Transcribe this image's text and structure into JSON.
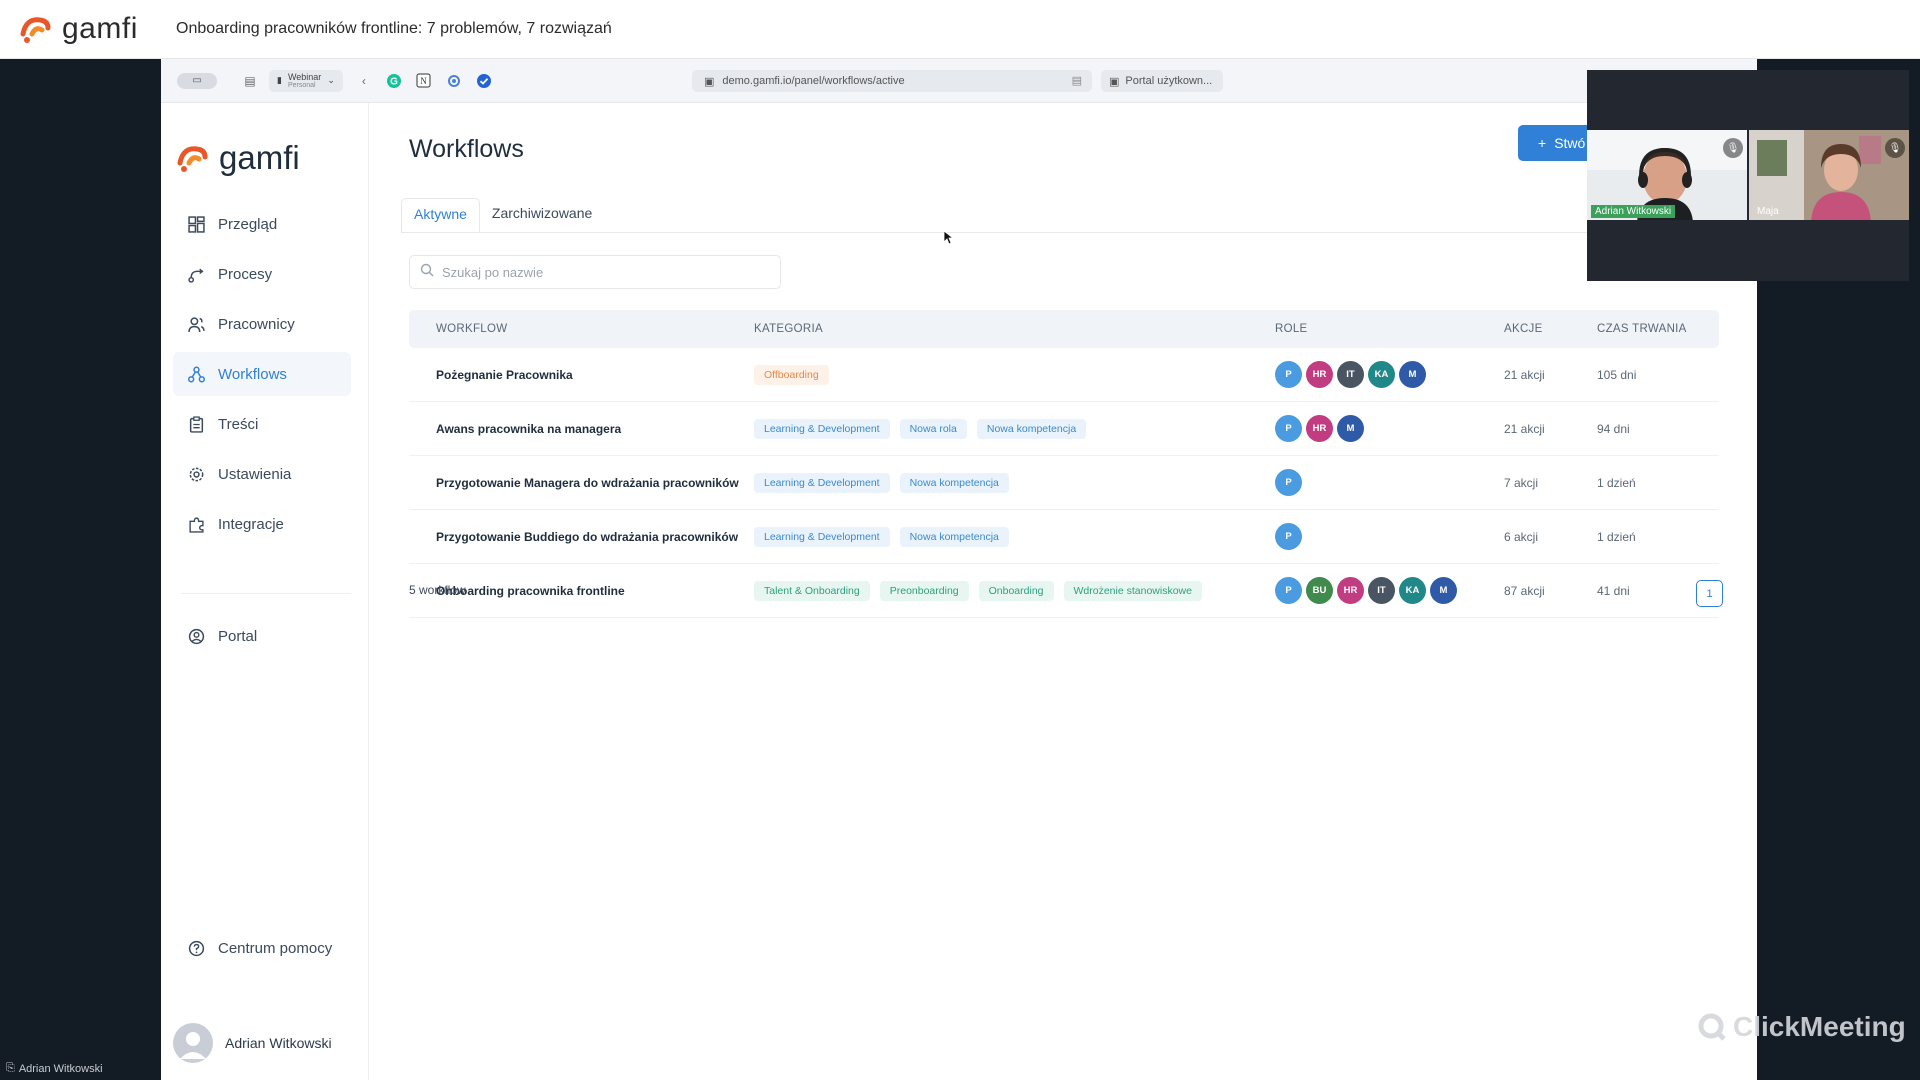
{
  "webinar": {
    "logo_text": "gamfi",
    "title": "Onboarding pracowników frontline: 7 problemów, 7 rozwiązań",
    "presenter": "Adrian Witkowski",
    "watermark": "ClickMeeting"
  },
  "browser": {
    "profile_label": "Webinar",
    "profile_sub": "Personal",
    "url": "demo.gamfi.io/panel/workflows/active",
    "second_tab": "Portal użytkown..."
  },
  "sidebar": {
    "logo_text": "gamfi",
    "items": [
      {
        "label": "Przegląd",
        "icon": "grid-icon"
      },
      {
        "label": "Procesy",
        "icon": "route-icon"
      },
      {
        "label": "Pracownicy",
        "icon": "users-icon"
      },
      {
        "label": "Workflows",
        "icon": "workflow-icon",
        "active": true
      },
      {
        "label": "Treści",
        "icon": "clipboard-icon"
      },
      {
        "label": "Ustawienia",
        "icon": "gear-icon"
      },
      {
        "label": "Integracje",
        "icon": "puzzle-icon"
      }
    ],
    "portal": "Portal",
    "help": "Centrum pomocy",
    "user": "Adrian Witkowski"
  },
  "main": {
    "title": "Workflows",
    "create_label": "Stwó",
    "tabs": [
      "Aktywne",
      "Zarchiwizowane"
    ],
    "search_placeholder": "Szukaj po nazwie",
    "columns": [
      "WORKFLOW",
      "KATEGORIA",
      "ROLE",
      "AKCJE",
      "CZAS TRWANIA"
    ],
    "rows": [
      {
        "name": "Pożegnanie Pracownika",
        "tags": [
          {
            "label": "Offboarding",
            "color": "orange"
          }
        ],
        "roles": [
          "P",
          "HR",
          "IT",
          "KA",
          "M"
        ],
        "actions": "21 akcji",
        "duration": "105 dni"
      },
      {
        "name": "Awans pracownika na managera",
        "tags": [
          {
            "label": "Learning & Development",
            "color": "blue"
          },
          {
            "label": "Nowa rola",
            "color": "blue"
          },
          {
            "label": "Nowa kompetencja",
            "color": "blue"
          }
        ],
        "roles": [
          "P",
          "HR",
          "M"
        ],
        "actions": "21 akcji",
        "duration": "94 dni"
      },
      {
        "name": "Przygotowanie Managera do wdrażania pracowników",
        "tags": [
          {
            "label": "Learning & Development",
            "color": "blue"
          },
          {
            "label": "Nowa kompetencja",
            "color": "blue"
          }
        ],
        "roles": [
          "P"
        ],
        "actions": "7 akcji",
        "duration": "1 dzień"
      },
      {
        "name": "Przygotowanie Buddiego do wdrażania pracowników",
        "tags": [
          {
            "label": "Learning & Development",
            "color": "blue"
          },
          {
            "label": "Nowa kompetencja",
            "color": "blue"
          }
        ],
        "roles": [
          "P"
        ],
        "actions": "6 akcji",
        "duration": "1 dzień"
      },
      {
        "name": "Onboarding pracownika frontline",
        "tags": [
          {
            "label": "Talent & Onboarding",
            "color": "green"
          },
          {
            "label": "Preonboarding",
            "color": "green"
          },
          {
            "label": "Onboarding",
            "color": "green"
          },
          {
            "label": "Wdrożenie stanowiskowe",
            "color": "green"
          }
        ],
        "roles": [
          "P",
          "BU",
          "HR",
          "IT",
          "KA",
          "M"
        ],
        "actions": "87 akcji",
        "duration": "41 dni"
      }
    ],
    "count": "5 workflow",
    "page": "1"
  },
  "role_colors": {
    "P": "#4a9be0",
    "HR": "#c23c82",
    "IT": "#4a5563",
    "KA": "#21888a",
    "M": "#2f5aa8",
    "BU": "#3f8a4c"
  },
  "video": {
    "participants": [
      "Adrian Witkowski",
      "Maja"
    ]
  }
}
